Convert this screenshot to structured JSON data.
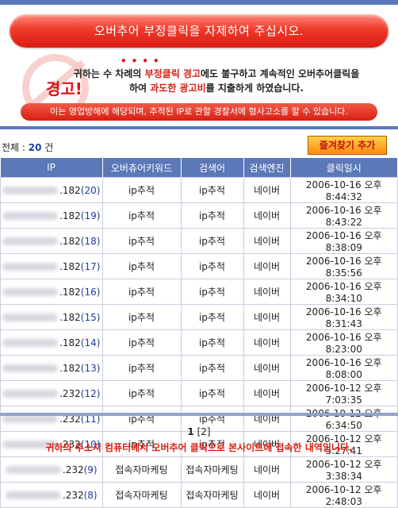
{
  "banner": {
    "text": "오버추어 부정클릭을 자제하여 주십시오."
  },
  "warning": {
    "stamp": "경고!",
    "line1_a": "귀하는 수 차례의 ",
    "line1_b": "부정클릭 경고",
    "line1_c": "에도 불구하고 계속적인 오버추어클릭을",
    "line2_a": "하여 ",
    "line2_b": "과도한 광고비",
    "line2_c": "를 지출하게 하였습니다.",
    "notice": "이는 영업방해에 해당되며, 추적된 IP로 관할 경찰서에 형사고소를 할 수 있습니다."
  },
  "summary": {
    "label": "전체 : ",
    "count": "20",
    "unit": " 건"
  },
  "favorite_button": "즐겨찾기 추가",
  "table": {
    "headers": [
      "IP",
      "오버츄어키워드",
      "검색어",
      "검색엔진",
      "클릭일시"
    ],
    "rows": [
      {
        "ip_suffix": ".182",
        "ip_no": "(20)",
        "keyword": "ip추적",
        "query": "ip추적",
        "engine": "네이버",
        "datetime": "2006-10-16 오후 8:44:32"
      },
      {
        "ip_suffix": ".182",
        "ip_no": "(19)",
        "keyword": "ip추적",
        "query": "ip추적",
        "engine": "네이버",
        "datetime": "2006-10-16 오후 8:43:22"
      },
      {
        "ip_suffix": ".182",
        "ip_no": "(18)",
        "keyword": "ip추적",
        "query": "ip추적",
        "engine": "네이버",
        "datetime": "2006-10-16 오후 8:38:09"
      },
      {
        "ip_suffix": ".182",
        "ip_no": "(17)",
        "keyword": "ip추적",
        "query": "ip추적",
        "engine": "네이버",
        "datetime": "2006-10-16 오후 8:35:56"
      },
      {
        "ip_suffix": ".182",
        "ip_no": "(16)",
        "keyword": "ip추적",
        "query": "ip추적",
        "engine": "네이버",
        "datetime": "2006-10-16 오후 8:34:10"
      },
      {
        "ip_suffix": ".182",
        "ip_no": "(15)",
        "keyword": "ip추적",
        "query": "ip추적",
        "engine": "네이버",
        "datetime": "2006-10-16 오후 8:31:43"
      },
      {
        "ip_suffix": ".182",
        "ip_no": "(14)",
        "keyword": "ip추적",
        "query": "ip추적",
        "engine": "네이버",
        "datetime": "2006-10-16 오후 8:23:00"
      },
      {
        "ip_suffix": ".182",
        "ip_no": "(13)",
        "keyword": "ip추적",
        "query": "ip추적",
        "engine": "네이버",
        "datetime": "2006-10-16 오후 8:08:00"
      },
      {
        "ip_suffix": ".232",
        "ip_no": "(12)",
        "keyword": "ip추적",
        "query": "ip추적",
        "engine": "네이버",
        "datetime": "2006-10-12 오후 7:03:35"
      },
      {
        "ip_suffix": ".232",
        "ip_no": "(11)",
        "keyword": "ip추적",
        "query": "ip추적",
        "engine": "네이버",
        "datetime": "2006-10-12 오후 6:34:50"
      },
      {
        "ip_suffix": ".232",
        "ip_no": "(10)",
        "keyword": "ip추적",
        "query": "ip추적",
        "engine": "네이버",
        "datetime": "2006-10-12 오후 5:27:41"
      },
      {
        "ip_suffix": ".232",
        "ip_no": "(9)",
        "keyword": "접속자마케팅",
        "query": "접속자마케팅",
        "engine": "네이버",
        "datetime": "2006-10-12 오후 3:38:34"
      },
      {
        "ip_suffix": ".232",
        "ip_no": "(8)",
        "keyword": "접속자마케팅",
        "query": "접속자마케팅",
        "engine": "네이버",
        "datetime": "2006-10-12 오후 2:48:03"
      }
    ]
  },
  "pagination": {
    "current": "1",
    "next": "[2]"
  },
  "footer": "귀하의 주소지 컴퓨터에서 오버추어 클릭으로 본사이트에 접속한 내역입니다.",
  "colors": {
    "accent": "#5b78b8",
    "warning_red": "#d81e12",
    "link_blue": "#1f3da0"
  }
}
